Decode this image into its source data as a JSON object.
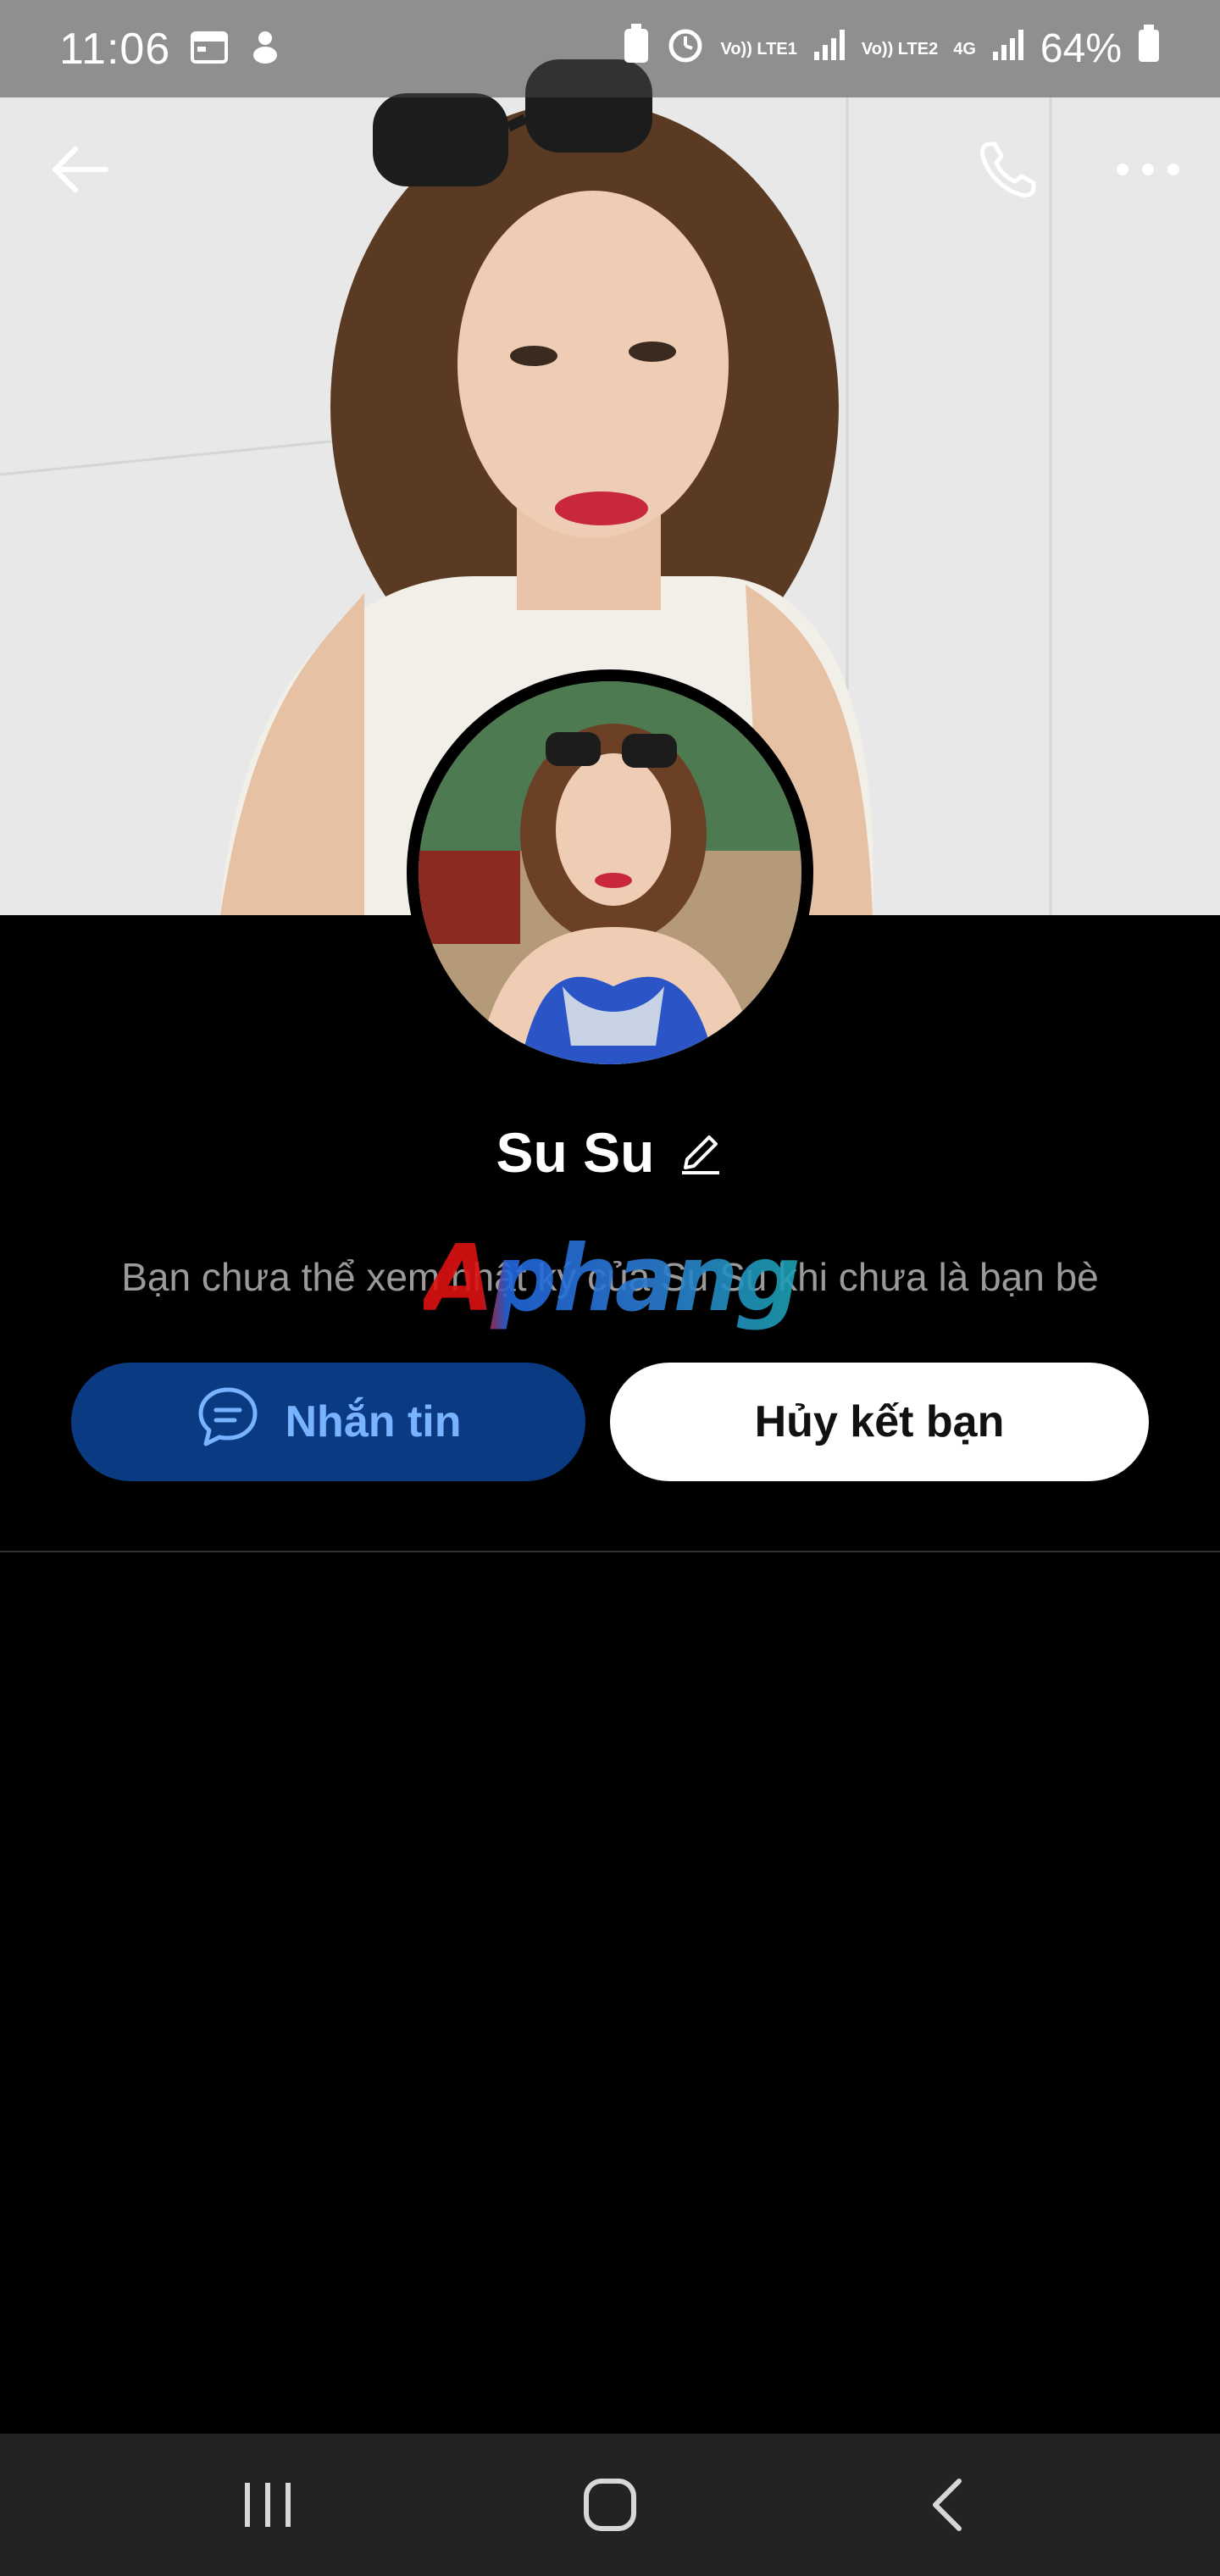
{
  "status_bar": {
    "time": "11:06",
    "network_1": "Vo)) LTE1",
    "network_2": "Vo)) LTE2",
    "network_type": "4G",
    "battery": "64%"
  },
  "topbar": {
    "back_icon": "arrow-left-icon",
    "call_icon": "phone-icon",
    "more_icon": "more-horizontal-icon"
  },
  "profile": {
    "name": "Su Su",
    "edit_icon": "pencil-icon",
    "notice": "Bạn chưa thể xem nhật ký của Su Su khi chưa là bạn bè",
    "watermark": "Aphang"
  },
  "actions": {
    "message_label": "Nhắn tin",
    "unfriend_label": "Hủy kết bạn"
  },
  "colors": {
    "message_button_bg": "#0a3a82",
    "message_button_text": "#79b2ff",
    "unfriend_button_bg": "#ffffff",
    "background": "#000000"
  },
  "navbar": {
    "recent_icon": "recent-apps-icon",
    "home_icon": "home-icon",
    "back_icon": "nav-back-icon"
  }
}
